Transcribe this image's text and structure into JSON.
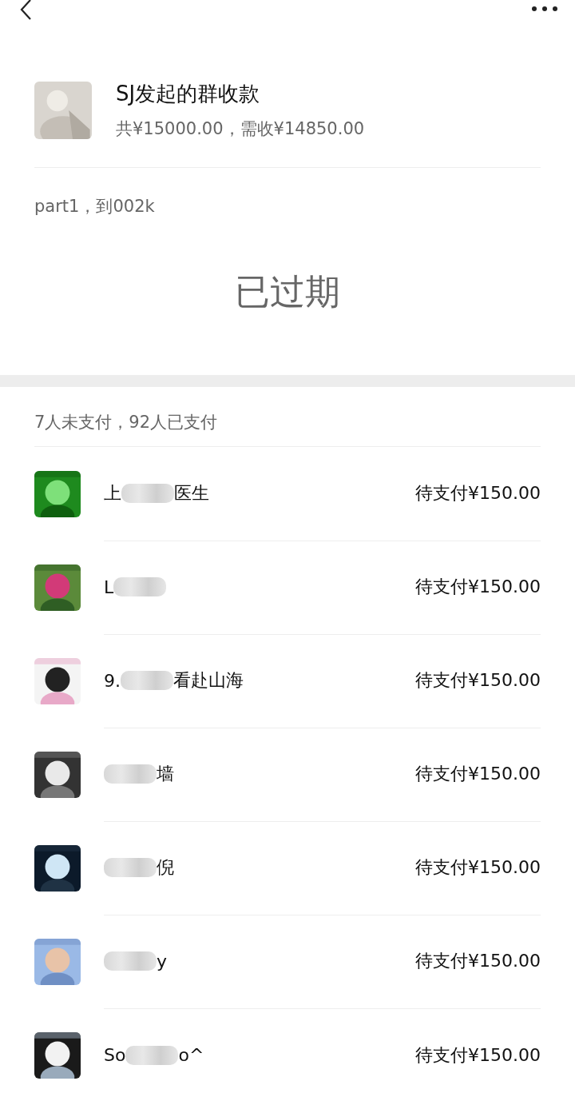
{
  "header": {
    "title": "SJ发起的群收款",
    "summary": "共¥15000.00，需收¥14850.00"
  },
  "note": "part1，到002k",
  "status": "已过期",
  "payments": {
    "summary": "7人未支付，92人已支付",
    "rows": [
      {
        "name_start": "上",
        "name_end": "医生",
        "amount": "待支付¥150.00"
      },
      {
        "name_start": "L",
        "amount": "待支付¥150.00"
      },
      {
        "name_start": "9.",
        "name_end": "看赴山海",
        "amount": "待支付¥150.00"
      },
      {
        "name_end": "墙",
        "amount": "待支付¥150.00"
      },
      {
        "name_end": "倪",
        "amount": "待支付¥150.00"
      },
      {
        "name_end": "y",
        "amount": "待支付¥150.00"
      },
      {
        "name_start": "So",
        "name_end": "o^",
        "amount": "待支付¥150.00"
      }
    ]
  }
}
